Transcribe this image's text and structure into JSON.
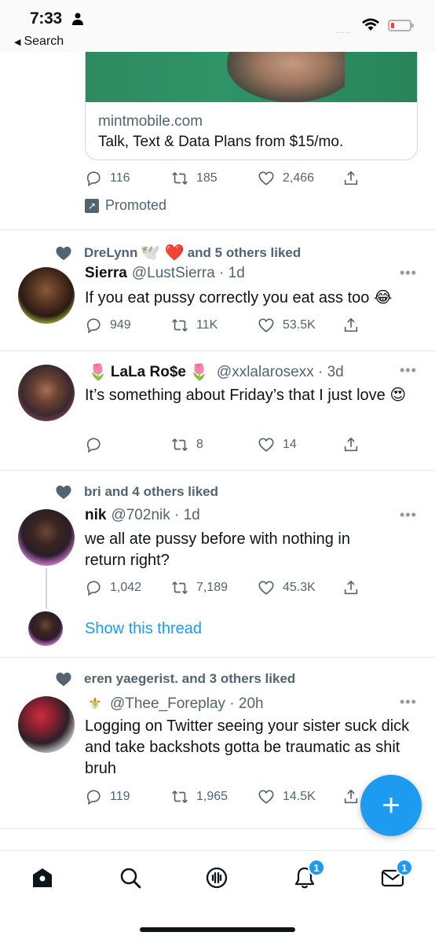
{
  "status_bar": {
    "time": "7:33",
    "back_label": "Search",
    "cellular": "....."
  },
  "promoted_card": {
    "domain": "mintmobile.com",
    "title": "Talk, Text & Data Plans from $15/mo.",
    "stats": {
      "replies": "116",
      "retweets": "185",
      "likes": "2,466"
    },
    "promoted_label": "Promoted",
    "promoted_icon": "↗"
  },
  "tweets": [
    {
      "social_context": "DreLynn",
      "social_emoji": "🕊️ ❤️",
      "social_suffix": "and 5 others liked",
      "name": "Sierra",
      "handle_time": "@LustSierra · 1d",
      "text": "If you eat pussy correctly you eat ass too 😂",
      "stats": {
        "replies": "949",
        "retweets": "11K",
        "likes": "53.5K"
      }
    },
    {
      "name_prefix_emoji": "🌷",
      "name": "LaLa Ro$e",
      "name_suffix_emoji": "🌷",
      "handle_time": "@xxlalarosexx · 3d",
      "text": "It’s something about Friday’s that I just love 😍",
      "stats": {
        "replies": "",
        "retweets": "8",
        "likes": "14"
      }
    },
    {
      "social_context": "bri and 4 others liked",
      "name": "nik",
      "handle_time": "@702nik · 1d",
      "text": "we all ate pussy before with nothing in return right?",
      "stats": {
        "replies": "1,042",
        "retweets": "7,189",
        "likes": "45.3K"
      },
      "show_thread": "Show this thread"
    },
    {
      "social_context": "eren yaegerist. and 3 others liked",
      "name_emoji": "⚜",
      "handle_time": "@Thee_Foreplay · 20h",
      "text": "Logging on Twitter seeing your sister suck dick and take backshots gotta be traumatic as shit bruh",
      "stats": {
        "replies": "119",
        "retweets": "1,965",
        "likes": "14.5K"
      }
    }
  ],
  "more_glyph": "•••",
  "fab_label": "+",
  "tabbar": {
    "notifications_badge": "1",
    "messages_badge": "1"
  },
  "colors": {
    "accent": "#1d9bf0",
    "muted": "#536471",
    "text": "#0f1419"
  }
}
